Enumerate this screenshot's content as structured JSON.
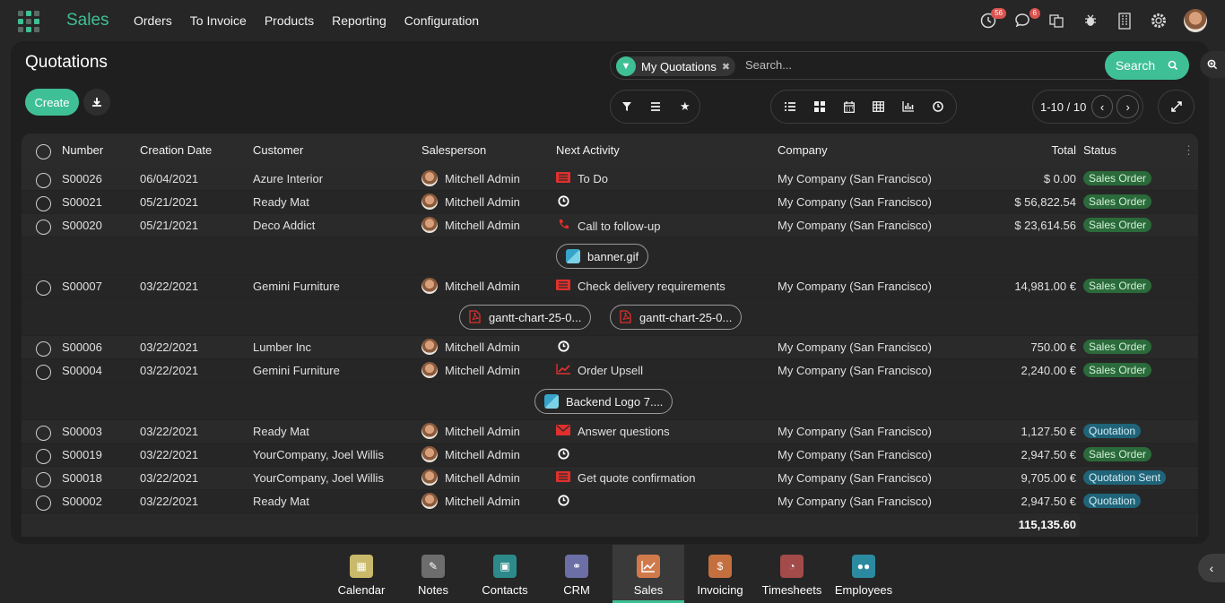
{
  "app": {
    "brand": "Sales",
    "menu": [
      "Orders",
      "To Invoice",
      "Products",
      "Reporting",
      "Configuration"
    ],
    "badges": {
      "activities": "56",
      "messages": "6"
    }
  },
  "page": {
    "title": "Quotations",
    "create_label": "Create",
    "facet_label": "My Quotations",
    "search_placeholder": "Search...",
    "search_label": "Search",
    "pager": "1-10 / 10"
  },
  "table": {
    "headers": [
      "Number",
      "Creation Date",
      "Customer",
      "Salesperson",
      "Next Activity",
      "Company",
      "Total",
      "Status"
    ],
    "rows": [
      {
        "number": "S00026",
        "date": "06/04/2021",
        "customer": "Azure Interior",
        "salesperson": "Mitchell Admin",
        "activity_icon": "todo-icon",
        "activity": "To Do",
        "company": "My Company (San Francisco)",
        "total": "$ 0.00",
        "status": "Sales Order",
        "status_kind": "so"
      },
      {
        "number": "S00021",
        "date": "05/21/2021",
        "customer": "Ready Mat",
        "salesperson": "Mitchell Admin",
        "activity_icon": "clock-icon",
        "activity": "",
        "company": "My Company (San Francisco)",
        "total": "$ 56,822.54",
        "status": "Sales Order",
        "status_kind": "so"
      },
      {
        "number": "S00020",
        "date": "05/21/2021",
        "customer": "Deco Addict",
        "salesperson": "Mitchell Admin",
        "activity_icon": "phone-icon",
        "activity": "Call to follow-up",
        "company": "My Company (San Francisco)",
        "total": "$ 23,614.56",
        "status": "Sales Order",
        "status_kind": "so"
      },
      {
        "number": "S00007",
        "date": "03/22/2021",
        "customer": "Gemini Furniture",
        "salesperson": "Mitchell Admin",
        "activity_icon": "todo-icon",
        "activity": "Check delivery requirements",
        "company": "My Company (San Francisco)",
        "total": "14,981.00 €",
        "status": "Sales Order",
        "status_kind": "so"
      },
      {
        "number": "S00006",
        "date": "03/22/2021",
        "customer": "Lumber Inc",
        "salesperson": "Mitchell Admin",
        "activity_icon": "clock-icon",
        "activity": "",
        "company": "My Company (San Francisco)",
        "total": "750.00 €",
        "status": "Sales Order",
        "status_kind": "so"
      },
      {
        "number": "S00004",
        "date": "03/22/2021",
        "customer": "Gemini Furniture",
        "salesperson": "Mitchell Admin",
        "activity_icon": "chart-icon",
        "activity": "Order Upsell",
        "company": "My Company (San Francisco)",
        "total": "2,240.00 €",
        "status": "Sales Order",
        "status_kind": "so"
      },
      {
        "number": "S00003",
        "date": "03/22/2021",
        "customer": "Ready Mat",
        "salesperson": "Mitchell Admin",
        "activity_icon": "mail-icon",
        "activity": "Answer questions",
        "company": "My Company (San Francisco)",
        "total": "1,127.50 €",
        "status": "Quotation",
        "status_kind": "q"
      },
      {
        "number": "S00019",
        "date": "03/22/2021",
        "customer": "YourCompany, Joel Willis",
        "salesperson": "Mitchell Admin",
        "activity_icon": "clock-icon",
        "activity": "",
        "company": "My Company (San Francisco)",
        "total": "2,947.50 €",
        "status": "Sales Order",
        "status_kind": "so"
      },
      {
        "number": "S00018",
        "date": "03/22/2021",
        "customer": "YourCompany, Joel Willis",
        "salesperson": "Mitchell Admin",
        "activity_icon": "todo-icon",
        "activity": "Get quote confirmation",
        "company": "My Company (San Francisco)",
        "total": "9,705.00 €",
        "status": "Quotation Sent",
        "status_kind": "q"
      },
      {
        "number": "S00002",
        "date": "03/22/2021",
        "customer": "Ready Mat",
        "salesperson": "Mitchell Admin",
        "activity_icon": "clock-icon",
        "activity": "",
        "company": "My Company (San Francisco)",
        "total": "2,947.50 €",
        "status": "Quotation",
        "status_kind": "q"
      }
    ],
    "attachments": {
      "after_S00020": [
        "banner.gif"
      ],
      "after_S00007": [
        "gantt-chart-25-0...",
        "gantt-chart-25-0..."
      ],
      "after_S00004": [
        "Backend Logo 7...."
      ]
    },
    "sum_total": "115,135.60"
  },
  "dock": [
    "Calendar",
    "Notes",
    "Contacts",
    "CRM",
    "Sales",
    "Invoicing",
    "Timesheets",
    "Employees"
  ],
  "colors": {
    "accent": "#3fbf95",
    "sales_order": "#2b6a3a",
    "quotation": "#1f6479",
    "activity_red": "#e0302d"
  }
}
